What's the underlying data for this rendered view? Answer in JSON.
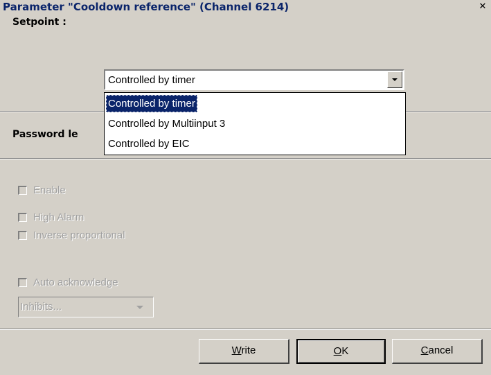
{
  "dialog": {
    "title": "Parameter \"Cooldown reference\" (Channel 6214)",
    "close_symbol": "✕"
  },
  "setpoint": {
    "label": "Setpoint :",
    "selected_value": "Controlled by timer",
    "options": [
      "Controlled by timer",
      "Controlled by Multiinput 3",
      "Controlled by EIC"
    ],
    "highlighted_index": 0
  },
  "password": {
    "label": "Password le"
  },
  "alarm": {
    "checkboxes": [
      {
        "label": "Enable",
        "checked": false,
        "enabled": false
      },
      {
        "label": "High Alarm",
        "checked": false,
        "enabled": false
      },
      {
        "label": "Inverse proportional",
        "checked": false,
        "enabled": false
      },
      {
        "label": "Auto acknowledge",
        "checked": false,
        "enabled": false
      }
    ],
    "inhibits": {
      "value": "Inhibits...",
      "enabled": false
    }
  },
  "buttons": {
    "write": {
      "mnemonic": "W",
      "rest": "rite"
    },
    "ok": {
      "mnemonic": "O",
      "rest": "K"
    },
    "cancel": {
      "mnemonic": "C",
      "rest": "ancel"
    }
  }
}
